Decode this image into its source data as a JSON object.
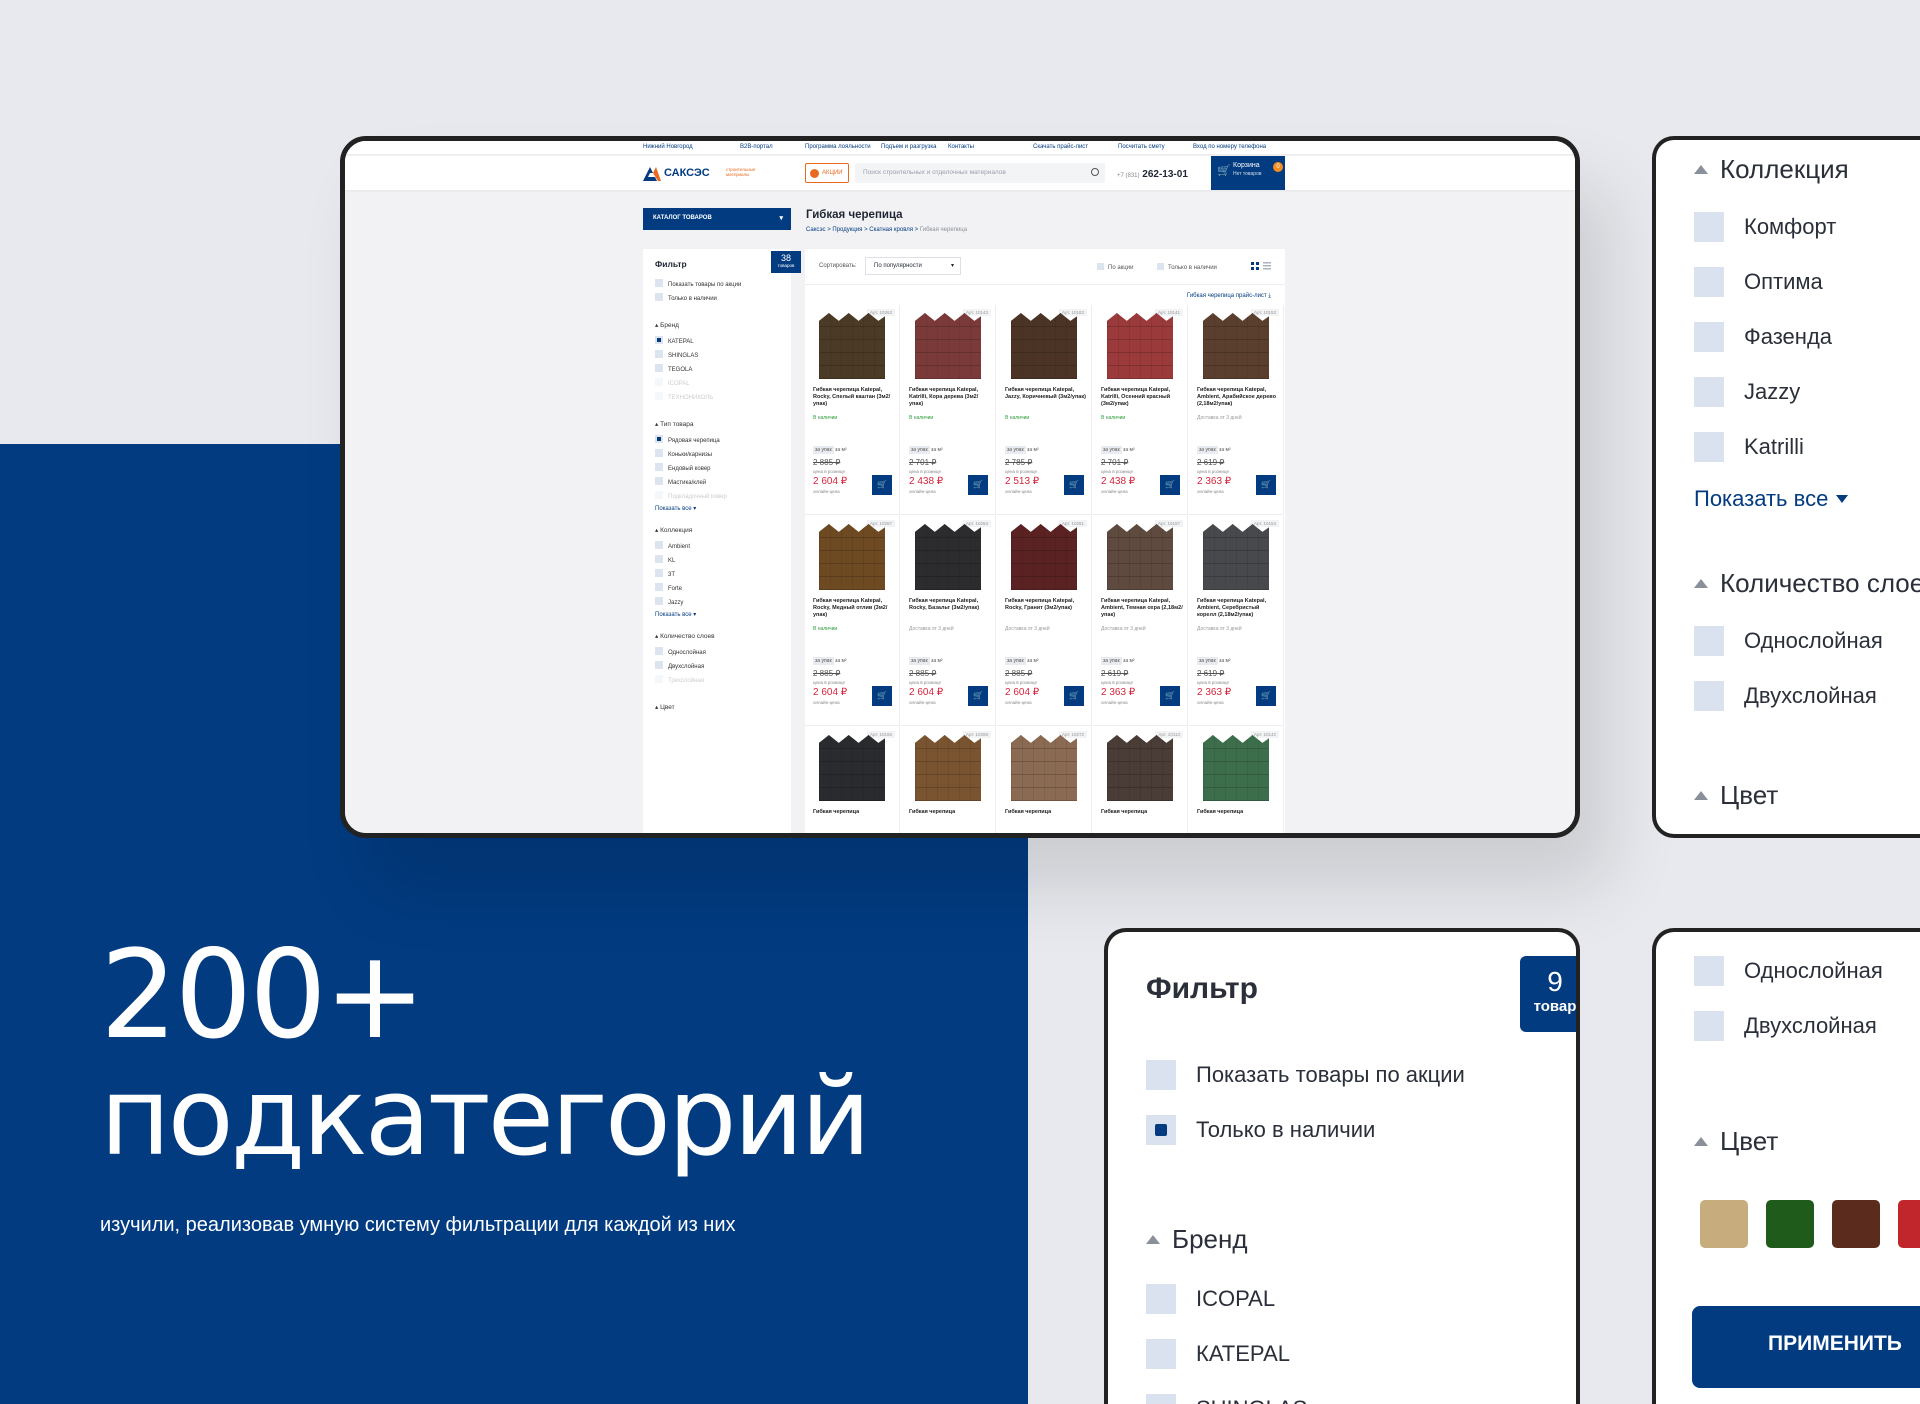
{
  "hero": {
    "number": "200+",
    "word": "подкатегорий",
    "subtitle": "изучили, реализовав умную систему фильтрации для каждой из них"
  },
  "site": {
    "topbar": [
      "Нижний Новгород",
      "B2B-портал",
      "Программа лояльности",
      "Подъем и разгрузка",
      "Контакты",
      "Скачать прайс-лист",
      "Посчитать смету",
      "Вход по номеру телефона"
    ],
    "logo": "САКСЭС",
    "logo_sub": "строительные материалы",
    "promo": "АКЦИИ",
    "search_placeholder": "Поиск строительных и отделочных материалов",
    "phone_code": "+7 (831)",
    "phone": "262-13-01",
    "cart_label": "Корзина",
    "cart_sub": "Нет товаров",
    "cart_count": "0",
    "catalog": "КАТАЛОГ ТОВАРОВ",
    "page_title": "Гибкая черепица",
    "breadcrumbs": [
      "Саксэс",
      "Продукция",
      "Скатная кровля",
      "Гибкая черепица"
    ],
    "filter_title": "Фильтр",
    "found_count": "38",
    "found_word": "товаров",
    "filter_top": [
      "Показать товары по акции",
      "Только в наличии"
    ],
    "brand_title": "Бренд",
    "brands": [
      "КАТЕРАL",
      "SHINGLAS",
      "TEGOLA",
      "ICOPAL",
      "ТЕХНОНИКОЛЬ"
    ],
    "type_title": "Тип товара",
    "types": [
      "Рядовая черепица",
      "Коньки/карнизы",
      "Ендовый ковер",
      "Мастика/клей",
      "Подкладочный ковер"
    ],
    "show_all": "Показать все",
    "collection_title": "Коллекция",
    "collections": [
      "Ambient",
      "KL",
      "3T",
      "Forte",
      "Jazzy"
    ],
    "layers_title": "Количество слоев",
    "layers": [
      "Однослойная",
      "Двухслойная",
      "Трехслойная"
    ],
    "color_title": "Цвет",
    "sort_label": "Сортировать:",
    "sort_value": "По популярности",
    "chk_promo": "По акции",
    "chk_stock": "Только в наличии",
    "pricelist": "Гибкая черепица прайс-лист",
    "per_label": "за упак",
    "per_unit": "за м²",
    "retail_label": "цена в рознице",
    "online_label": "онлайн-цена",
    "in_stock": "В наличии",
    "delivery": "Доставка от 3 дней",
    "products": [
      {
        "art": "Арт. 10263",
        "name": "Гибкая черепица Katepal, Rocky, Спелый каштан (3м2/упак)",
        "avail": "В наличии",
        "old": "2 885 ₽",
        "price": "2 604 ₽",
        "color": "#4a3a26"
      },
      {
        "art": "Арт. 10143",
        "name": "Гибкая черепица Katepal, Katrilli, Кора дерева (3м2/упак)",
        "avail": "В наличии",
        "old": "2 701 ₽",
        "price": "2 438 ₽",
        "color": "#7b3a3a"
      },
      {
        "art": "Арт. 10183",
        "name": "Гибкая черепица Katepal, Jazzy, Коричневый (3м2/упак)",
        "avail": "В наличии",
        "old": "2 785 ₽",
        "price": "2 513 ₽",
        "color": "#4b3426"
      },
      {
        "art": "Арт. 10141",
        "name": "Гибкая черепица Katepal, Katrilli, Осенний красный (3м2/упак)",
        "avail": "В наличии",
        "old": "2 701 ₽",
        "price": "2 438 ₽",
        "color": "#9a3a3a"
      },
      {
        "art": "Арт. 10153",
        "name": "Гибкая черепица Katepal, Ambient, Арабийское дерево (2,18м2/упак)",
        "avail": "Доставка от 3 дней",
        "old": "2 619 ₽",
        "price": "2 363 ₽",
        "color": "#5a3f2e"
      },
      {
        "art": "Арт. 10267",
        "name": "Гибкая черепица Katepal, Rocky, Медный отлив (3м2/упак)",
        "avail": "В наличии",
        "old": "2 885 ₽",
        "price": "2 604 ₽",
        "color": "#6e4a22"
      },
      {
        "art": "Арт. 10264",
        "name": "Гибкая черепица Katepal, Rocky, Базальт (3м2/упак)",
        "avail": "Доставка от 3 дней",
        "old": "2 885 ₽",
        "price": "2 604 ₽",
        "color": "#2c2c2e"
      },
      {
        "art": "Арт. 10261",
        "name": "Гибкая черепица Katepal, Rocky, Гранит (3м2/упак)",
        "avail": "Доставка от 3 дней",
        "old": "2 885 ₽",
        "price": "2 604 ₽",
        "color": "#5a2222"
      },
      {
        "art": "Арт. 10157",
        "name": "Гибкая черепица Katepal, Ambient, Темная охра (2,18м2/упак)",
        "avail": "Доставка от 3 дней",
        "old": "2 619 ₽",
        "price": "2 363 ₽",
        "color": "#5e4a3e"
      },
      {
        "art": "Арт. 10154",
        "name": "Гибкая черепица Katepal, Ambient, Серебристый корелл (2,18м2/упак)",
        "avail": "Доставка от 3 дней",
        "old": "2 619 ₽",
        "price": "2 363 ₽",
        "color": "#48494c"
      },
      {
        "art": "Арт. 10155",
        "name": "Гибкая черепица",
        "avail": "",
        "old": "",
        "price": "",
        "color": "#2a2b2e"
      },
      {
        "art": "Арт. 10268",
        "name": "Гибкая черепица",
        "avail": "",
        "old": "",
        "price": "",
        "color": "#7a5430"
      },
      {
        "art": "Арт. 10272",
        "name": "Гибкая черепица",
        "avail": "",
        "old": "",
        "price": "",
        "color": "#8a6a52"
      },
      {
        "art": "Арт. 10113",
        "name": "Гибкая черепица",
        "avail": "",
        "old": "",
        "price": "",
        "color": "#4a3c36"
      },
      {
        "art": "Арт. 10142",
        "name": "Гибкая черепица",
        "avail": "",
        "old": "",
        "price": "",
        "color": "#3d6e4c"
      }
    ]
  },
  "zoom_collection": {
    "title": "Коллекция",
    "items": [
      "Комфорт",
      "Оптима",
      "Фазенда",
      "Jazzy",
      "Katrilli"
    ],
    "show_all": "Показать все",
    "layers_title": "Количество слоев",
    "layers": [
      "Однослойная",
      "Двухслойная"
    ],
    "color_title": "Цвет"
  },
  "zoom_filter": {
    "title": "Фильтр",
    "badge_num": "9",
    "badge_word": "товар",
    "promo": "Показать товары по акции",
    "stock": "Только в наличии",
    "brand_title": "Бренд",
    "brands": [
      "ICOPAL",
      "КАТЕРАL",
      "SHINGLAS"
    ]
  },
  "zoom_color": {
    "layers": [
      "Однослойная",
      "Двухслойная"
    ],
    "color_title": "Цвет",
    "swatches": [
      "#c7ad7e",
      "#1f5c1c",
      "#5b2c1e",
      "#c0262b"
    ],
    "apply": "ПРИМЕНИТЬ"
  }
}
